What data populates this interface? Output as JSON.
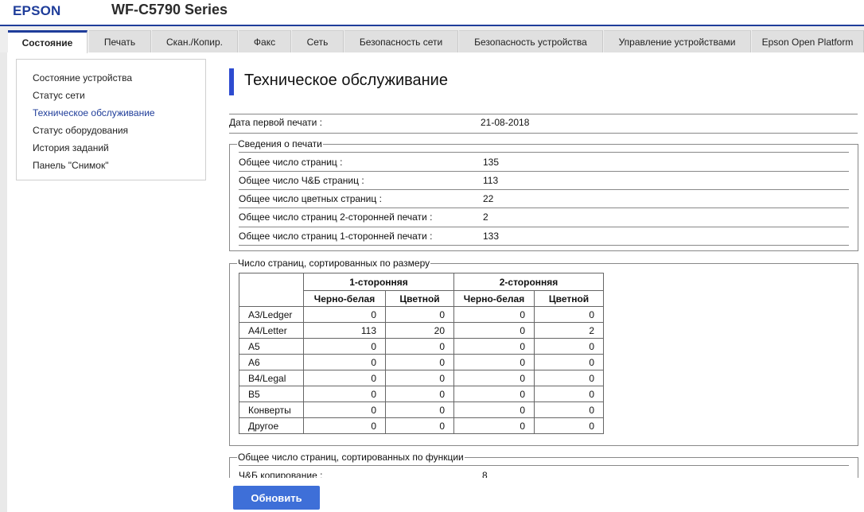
{
  "header": {
    "brand": "EPSON",
    "model": "WF-C5790 Series"
  },
  "tabs": [
    {
      "label": "Состояние",
      "active": true
    },
    {
      "label": "Печать"
    },
    {
      "label": "Скан./Копир."
    },
    {
      "label": "Факс"
    },
    {
      "label": "Сеть"
    },
    {
      "label": "Безопасность сети"
    },
    {
      "label": "Безопасность устройства"
    },
    {
      "label": "Управление устройствами"
    },
    {
      "label": "Epson Open Platform"
    }
  ],
  "sidebar": {
    "items": [
      {
        "label": "Состояние устройства"
      },
      {
        "label": "Статус сети"
      },
      {
        "label": "Техническое обслуживание",
        "active": true
      },
      {
        "label": "Статус оборудования"
      },
      {
        "label": "История заданий"
      },
      {
        "label": "Панель \"Снимок\""
      }
    ]
  },
  "main": {
    "title": "Техническое обслуживание",
    "first_print": {
      "label": "Дата первой печати :",
      "value": "21-08-2018"
    },
    "print_info": {
      "legend": "Сведения о печати",
      "rows": [
        {
          "label": "Общее число страниц :",
          "value": "135"
        },
        {
          "label": "Общее число Ч&Б страниц :",
          "value": "113"
        },
        {
          "label": "Общее число цветных страниц :",
          "value": "22"
        },
        {
          "label": "Общее число страниц 2-сторонней печати :",
          "value": "2"
        },
        {
          "label": "Общее число страниц 1-сторонней печати :",
          "value": "133"
        }
      ]
    },
    "by_size": {
      "legend": "Число страниц, сортированных по размеру",
      "group_headers": [
        "1-сторонняя",
        "2-сторонняя"
      ],
      "sub_headers": [
        "Черно-белая",
        "Цветной",
        "Черно-белая",
        "Цветной"
      ],
      "rows": [
        {
          "name": "A3/Ledger",
          "values": [
            "0",
            "0",
            "0",
            "0"
          ]
        },
        {
          "name": "A4/Letter",
          "values": [
            "113",
            "20",
            "0",
            "2"
          ]
        },
        {
          "name": "A5",
          "values": [
            "0",
            "0",
            "0",
            "0"
          ]
        },
        {
          "name": "A6",
          "values": [
            "0",
            "0",
            "0",
            "0"
          ]
        },
        {
          "name": "B4/Legal",
          "values": [
            "0",
            "0",
            "0",
            "0"
          ]
        },
        {
          "name": "B5",
          "values": [
            "0",
            "0",
            "0",
            "0"
          ]
        },
        {
          "name": "Конверты",
          "values": [
            "0",
            "0",
            "0",
            "0"
          ]
        },
        {
          "name": "Другое",
          "values": [
            "0",
            "0",
            "0",
            "0"
          ]
        }
      ]
    },
    "by_function": {
      "legend": "Общее число страниц, сортированных по функции",
      "rows": [
        {
          "label": "Ч&Б копирование :",
          "value": "8"
        }
      ]
    },
    "refresh_label": "Обновить"
  }
}
